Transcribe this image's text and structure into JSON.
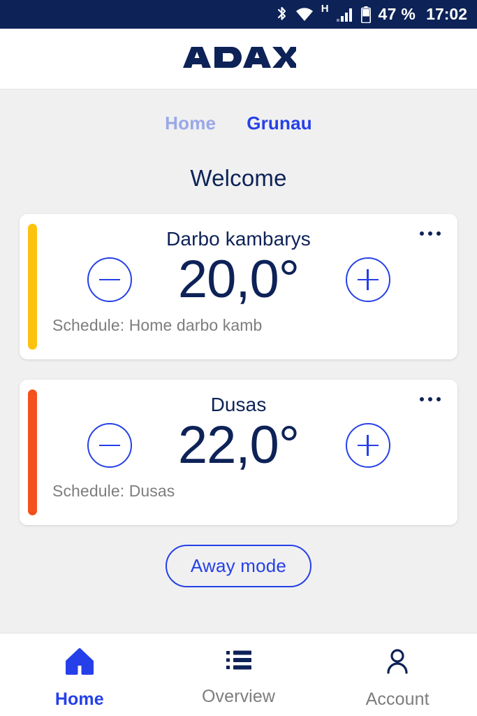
{
  "statusbar": {
    "bluetooth_icon": "bluetooth-icon",
    "wifi_icon": "wifi-icon",
    "network_type": "H",
    "signal_icon": "cellular-signal-icon",
    "battery_icon": "battery-icon",
    "battery_text": "47 %",
    "time": "17:02",
    "background": "#0d2257"
  },
  "header": {
    "brand": "ADAX",
    "logo_color": "#0d2257"
  },
  "tabs": {
    "items": [
      {
        "label": "Home",
        "state": "inactive",
        "color": "#9aa8e8"
      },
      {
        "label": "Grunau",
        "state": "active",
        "color": "#2540e8"
      }
    ]
  },
  "main": {
    "welcome": "Welcome",
    "away_button": "Away mode",
    "accent_blue": "#2540e8",
    "navy": "#0d2257",
    "background": "#f0f0f0"
  },
  "rooms": [
    {
      "name": "Darbo kambarys",
      "temperature": "20,0°",
      "schedule": "Schedule: Home darbo kamb",
      "accent_color": "#fdc20e",
      "decrease_icon": "minus-icon",
      "increase_icon": "plus-icon",
      "menu_icon": "more-options-icon"
    },
    {
      "name": "Dusas",
      "temperature": "22,0°",
      "schedule": "Schedule: Dusas",
      "accent_color": "#f4511e",
      "decrease_icon": "minus-icon",
      "increase_icon": "plus-icon",
      "menu_icon": "more-options-icon"
    }
  ],
  "bottomnav": {
    "items": [
      {
        "label": "Home",
        "icon": "home-icon",
        "active": true
      },
      {
        "label": "Overview",
        "icon": "list-icon",
        "active": false
      },
      {
        "label": "Account",
        "icon": "person-icon",
        "active": false
      }
    ]
  }
}
